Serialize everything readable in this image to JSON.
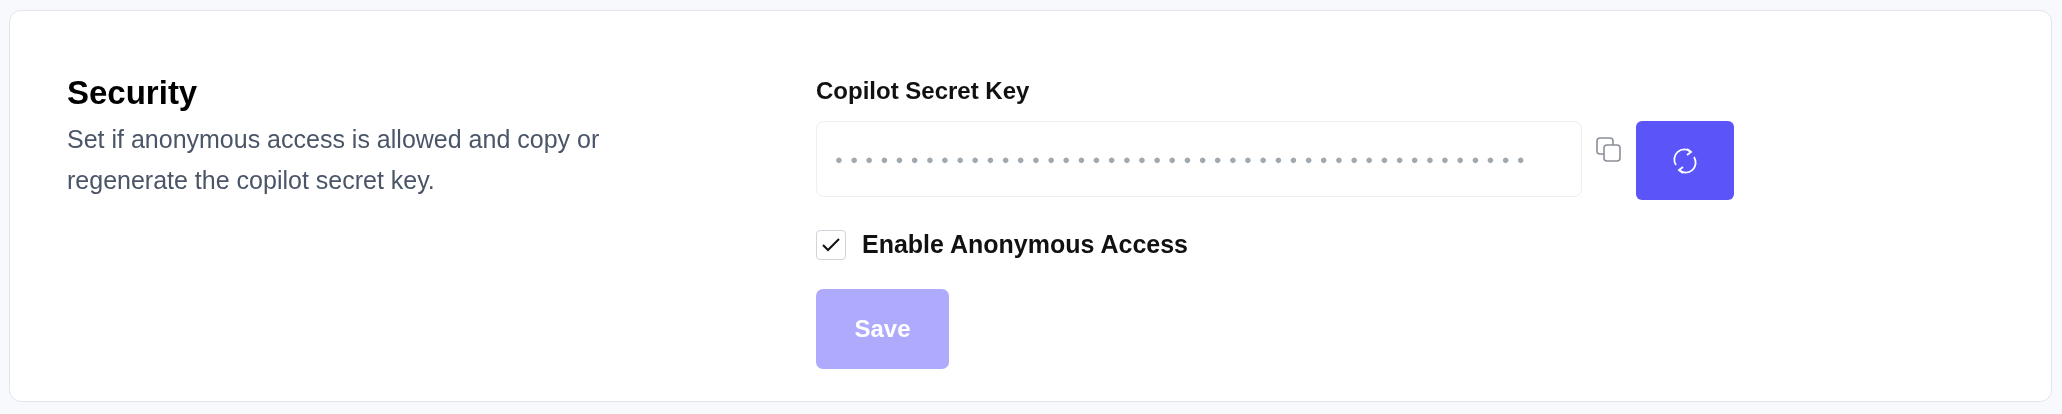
{
  "section": {
    "title": "Security",
    "description": "Set if anonymous access is allowed and copy or regenerate the copilot secret key."
  },
  "secret_key": {
    "label": "Copilot Secret Key",
    "value": "●●●●●●●●●●●●●●●●●●●●●●●●●●●●●●●●●●●●●●●●●●●●●●"
  },
  "anonymous_access": {
    "label": "Enable Anonymous Access",
    "checked": true
  },
  "save_button": {
    "label": "Save",
    "disabled": true
  }
}
